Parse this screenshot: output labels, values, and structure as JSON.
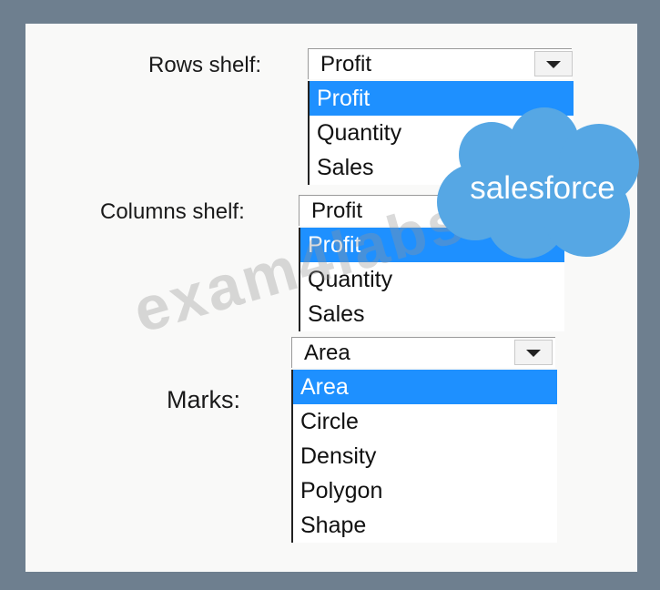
{
  "rows": {
    "label": "Rows shelf:",
    "selected": "Profit",
    "options": [
      "Profit",
      "Quantity",
      "Sales"
    ]
  },
  "columns": {
    "label": "Columns shelf:",
    "selected": "Profit",
    "options": [
      "Profit",
      "Quantity",
      "Sales"
    ]
  },
  "marks": {
    "label": "Marks:",
    "selected": "Area",
    "options": [
      "Area",
      "Circle",
      "Density",
      "Polygon",
      "Shape"
    ]
  },
  "watermark": {
    "text": "exam4labs.com"
  },
  "logo": {
    "text": "salesforce",
    "color": "#56a7e4"
  },
  "colors": {
    "highlight": "#1e90ff",
    "frame": "#6e7f8f"
  }
}
